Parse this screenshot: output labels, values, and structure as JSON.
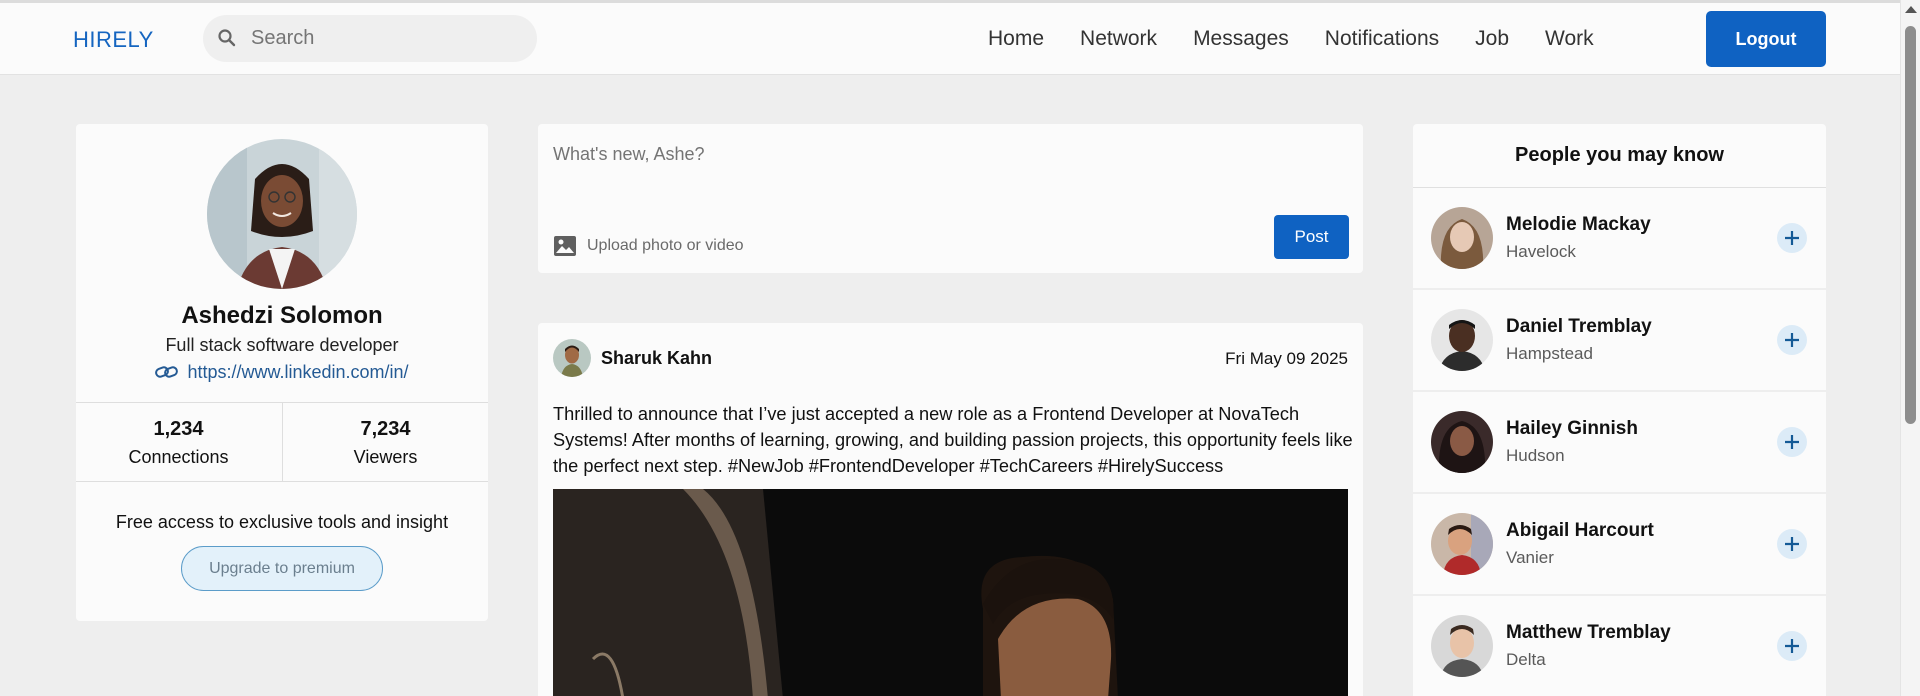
{
  "app": {
    "logo": "HIRELY"
  },
  "search": {
    "placeholder": "Search"
  },
  "nav": {
    "items": [
      "Home",
      "Network",
      "Messages",
      "Notifications",
      "Job",
      "Work"
    ],
    "logout": "Logout"
  },
  "profile": {
    "name": "Ashedzi Solomon",
    "title": "Full stack software developer",
    "link": "https://www.linkedin.com/in/",
    "connections": {
      "value": "1,234",
      "label": "Connections"
    },
    "viewers": {
      "value": "7,234",
      "label": "Viewers"
    },
    "promo": "Free access to exclusive tools and insight",
    "upgrade_label": "Upgrade to premium"
  },
  "composer": {
    "placeholder": "What's new, Ashe?",
    "upload_label": "Upload photo or video",
    "post_label": "Post"
  },
  "post": {
    "author": "Sharuk Kahn",
    "date": "Fri May 09 2025",
    "text": "Thrilled to announce that I’ve just accepted a new role as a Frontend Developer at NovaTech Systems! After months of learning, growing, and building passion projects, this opportunity feels like the perfect next step. #NewJob #FrontendDeveloper #TechCareers #HirelySuccess"
  },
  "people": {
    "title": "People you may know",
    "items": [
      {
        "name": "Melodie Mackay",
        "location": "Havelock"
      },
      {
        "name": "Daniel Tremblay",
        "location": "Hampstead"
      },
      {
        "name": "Hailey Ginnish",
        "location": "Hudson"
      },
      {
        "name": "Abigail Harcourt",
        "location": "Vanier"
      },
      {
        "name": "Matthew Tremblay",
        "location": "Delta"
      }
    ]
  },
  "colors": {
    "accent": "#0f62c2",
    "logo": "#1565c0",
    "background": "#eeeeee",
    "card": "#fbfbfb"
  }
}
